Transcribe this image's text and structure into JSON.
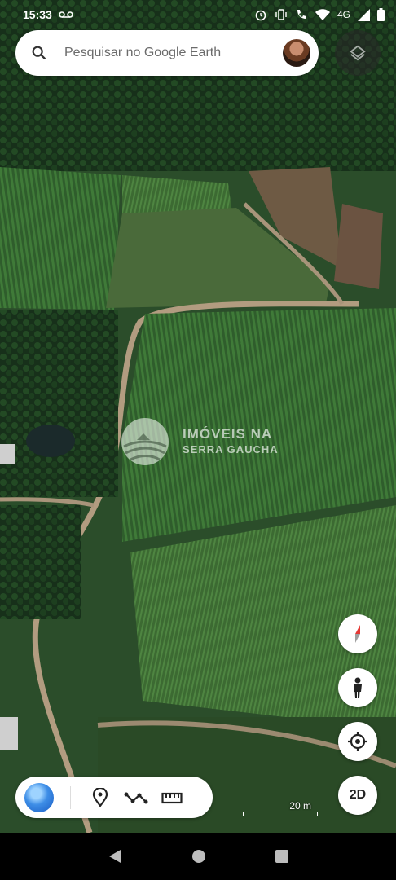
{
  "status_bar": {
    "time": "15:33",
    "network": "4G"
  },
  "search": {
    "placeholder": "Pesquisar no Google Earth"
  },
  "watermark": {
    "line1": "IMÓVEIS NA",
    "line2": "SERRA GAUCHA"
  },
  "map_controls": {
    "mode_label": "2D",
    "scale_label": "20 m"
  },
  "icons": {
    "search": "search-icon",
    "layers": "layers-icon",
    "compass": "compass-icon",
    "street_view": "pegman-icon",
    "my_location": "my-location-icon",
    "earth": "earth-icon",
    "place": "place-pin-icon",
    "path": "path-icon",
    "measure": "ruler-icon"
  },
  "colors": {
    "compass_red": "#e53935",
    "toolbar_bg": "#ffffff"
  }
}
